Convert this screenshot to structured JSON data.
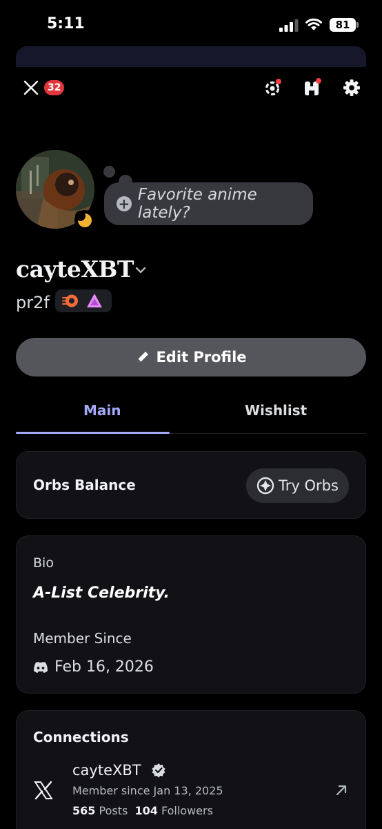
{
  "status_bar": {
    "time": "5:11",
    "battery": "81"
  },
  "topbar": {
    "notification_count": "32"
  },
  "profile": {
    "custom_status": "Favorite anime lately?",
    "display_name": "cayteXBT",
    "username": "pr2f"
  },
  "actions": {
    "edit_profile": "Edit Profile"
  },
  "tabs": [
    {
      "label": "Main"
    },
    {
      "label": "Wishlist"
    }
  ],
  "orbs": {
    "label": "Orbs Balance",
    "button": "Try Orbs"
  },
  "about": {
    "bio_label": "Bio",
    "bio_text": "A-List Celebrity.",
    "member_since_label": "Member Since",
    "member_since_date": "Feb 16, 2026"
  },
  "connections": {
    "title": "Connections",
    "items": [
      {
        "service_icon": "x-logo-icon",
        "name": "cayteXBT",
        "since": "Member since Jan 13, 2025",
        "posts_count": "565",
        "posts_label": "Posts",
        "followers_count": "104",
        "followers_label": "Followers"
      }
    ]
  },
  "colors": {
    "accent": "#a4aaf9",
    "badge_red": "#e0363c",
    "idle_status": "#f0b232",
    "card_bg": "#121216"
  }
}
